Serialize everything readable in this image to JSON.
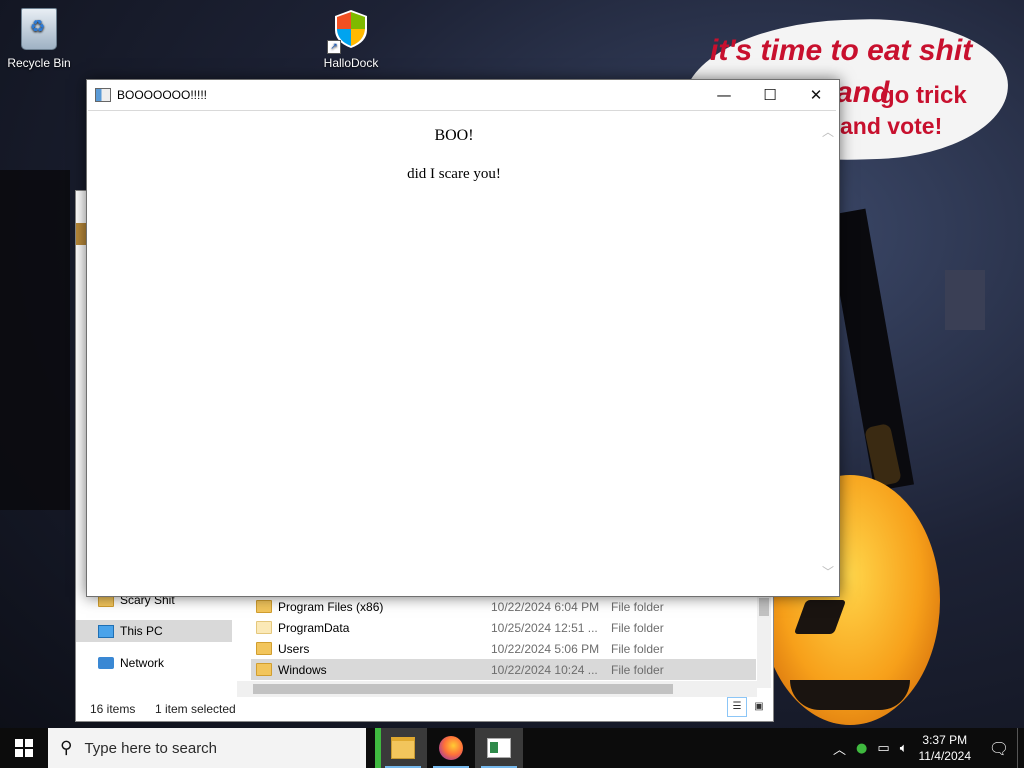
{
  "desktop": {
    "icons": [
      {
        "label": "Recycle Bin",
        "icon": "recycle-bin-icon"
      },
      {
        "label": "HalloDock",
        "icon": "security-shield-icon"
      }
    ],
    "wallpaper_text": {
      "line1": "it's time to eat shit",
      "line2": "and",
      "line3": "go trick",
      "line4": "and vote!"
    }
  },
  "dialog": {
    "title": "BOOOOOOO!!!!!",
    "heading": "BOO!",
    "body": "did I scare you!",
    "minimize_glyph": "—",
    "maximize_glyph": "☐",
    "close_glyph": "✕"
  },
  "explorer": {
    "nav_items": [
      {
        "label": "Scary Shit",
        "icon": "folder-icon"
      },
      {
        "label": "This PC",
        "icon": "computer-icon"
      },
      {
        "label": "Network",
        "icon": "network-icon"
      }
    ],
    "rows": [
      {
        "name": "Program Files (x86)",
        "date": "10/22/2024 6:04 PM",
        "type": "File folder"
      },
      {
        "name": "ProgramData",
        "date": "10/25/2024 12:51 ...",
        "type": "File folder"
      },
      {
        "name": "Users",
        "date": "10/22/2024 5:06 PM",
        "type": "File folder"
      },
      {
        "name": "Windows",
        "date": "10/22/2024 10:24 ...",
        "type": "File folder"
      }
    ],
    "status_count": "16 items",
    "status_selected": "1 item selected"
  },
  "taskbar": {
    "search_placeholder": "Type here to search",
    "apps": [
      "file-explorer-icon",
      "firefox-icon",
      "document-app-icon"
    ],
    "time": "3:37 PM",
    "date": "11/4/2024",
    "tray_up_glyph": "︿"
  },
  "colors": {
    "taskbar": "#0c0c0c",
    "speech_text": "#c8102e",
    "selection": "#cce8ff"
  }
}
